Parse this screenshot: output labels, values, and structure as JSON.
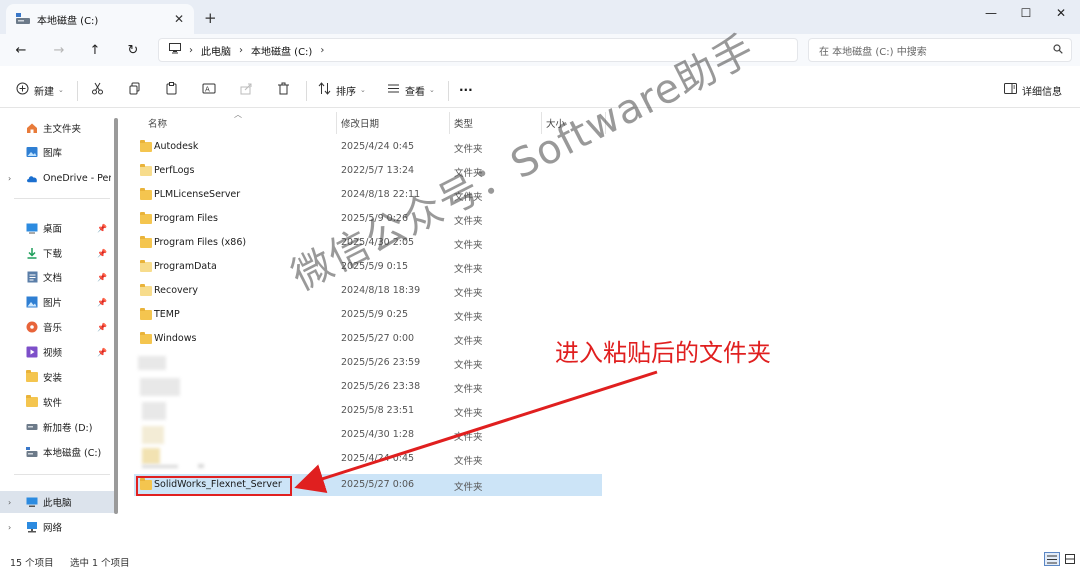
{
  "tab": {
    "title": "本地磁盘 (C:)",
    "close_glyph": "✕",
    "new_tab_glyph": "+"
  },
  "window_controls": {
    "minimize": "—",
    "maximize": "☐",
    "close": "✕"
  },
  "nav": {
    "back": "←",
    "forward": "→",
    "up": "↑",
    "refresh": "↻"
  },
  "breadcrumb": {
    "items": [
      "此电脑",
      "本地磁盘 (C:)"
    ],
    "sep": "›"
  },
  "search": {
    "placeholder": "在 本地磁盘 (C:) 中搜索",
    "icon": "search-icon"
  },
  "toolbar": {
    "new_label": "新建",
    "sort_label": "排序",
    "view_label": "查看",
    "more_label": "···",
    "details_label": "详细信息"
  },
  "sidebar": {
    "items": [
      {
        "label": "主文件夹",
        "icon": "home-icon"
      },
      {
        "label": "图库",
        "icon": "gallery-icon"
      },
      {
        "label": "OneDrive - Per",
        "icon": "cloud-icon"
      },
      {
        "label": "桌面",
        "icon": "desktop-icon"
      },
      {
        "label": "下载",
        "icon": "download-icon"
      },
      {
        "label": "文档",
        "icon": "documents-icon"
      },
      {
        "label": "图片",
        "icon": "pictures-icon"
      },
      {
        "label": "音乐",
        "icon": "music-icon"
      },
      {
        "label": "视频",
        "icon": "video-icon"
      },
      {
        "label": "安装",
        "icon": "folder-icon"
      },
      {
        "label": "软件",
        "icon": "folder-icon"
      },
      {
        "label": "新加卷 (D:)",
        "icon": "drive-icon"
      },
      {
        "label": "本地磁盘 (C:)",
        "icon": "drive-icon"
      },
      {
        "label": "此电脑",
        "icon": "pc-icon"
      },
      {
        "label": "网络",
        "icon": "network-icon"
      }
    ]
  },
  "columns": {
    "name": "名称",
    "date": "修改日期",
    "type": "类型",
    "size": "大小"
  },
  "files": [
    {
      "name": "Autodesk",
      "date": "2025/4/24 0:45",
      "type": "文件夹"
    },
    {
      "name": "PerfLogs",
      "date": "2022/5/7 13:24",
      "type": "文件夹"
    },
    {
      "name": "PLMLicenseServer",
      "date": "2024/8/18 22:11",
      "type": "文件夹"
    },
    {
      "name": "Program Files",
      "date": "2025/5/9 0:26",
      "type": "文件夹"
    },
    {
      "name": "Program Files (x86)",
      "date": "2025/4/30 2:05",
      "type": "文件夹"
    },
    {
      "name": "ProgramData",
      "date": "2025/5/9 0:15",
      "type": "文件夹"
    },
    {
      "name": "Recovery",
      "date": "2024/8/18 18:39",
      "type": "文件夹"
    },
    {
      "name": "TEMP",
      "date": "2025/5/9 0:25",
      "type": "文件夹"
    },
    {
      "name": "Windows",
      "date": "2025/5/27 0:00",
      "type": "文件夹"
    },
    {
      "name": "",
      "date": "2025/5/26 23:59",
      "type": "文件夹"
    },
    {
      "name": "",
      "date": "2025/5/26 23:38",
      "type": "文件夹"
    },
    {
      "name": "",
      "date": "2025/5/8 23:51",
      "type": "文件夹"
    },
    {
      "name": "",
      "date": "2025/4/30 1:28",
      "type": "文件夹"
    },
    {
      "name": "",
      "date": "2025/4/24 0:45",
      "type": "文件夹"
    },
    {
      "name": "SolidWorks_Flexnet_Server",
      "date": "2025/5/27 0:06",
      "type": "文件夹"
    }
  ],
  "status": {
    "count": "15 个项目",
    "selected": "选中 1 个项目"
  },
  "overlay": {
    "watermark": "微信公众号：Software助手",
    "annotation": "进入粘贴后的文件夹",
    "arrow_color": "#e01f1f"
  }
}
